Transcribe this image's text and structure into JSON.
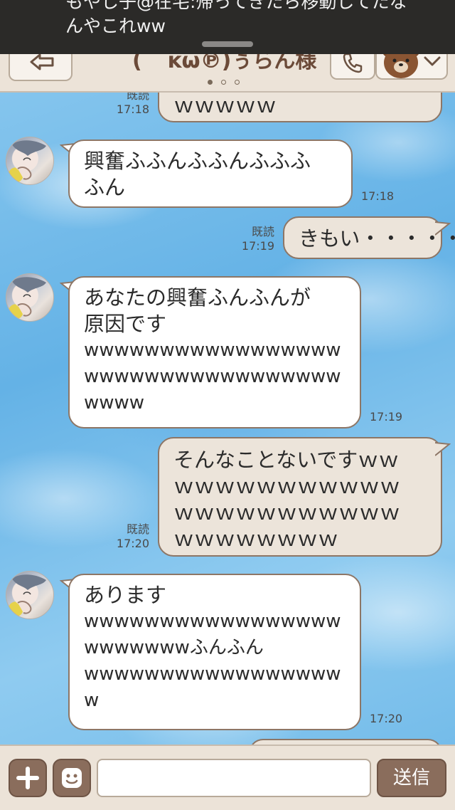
{
  "notification": {
    "text_line1": "もやし子@在宅:帰ってきたら移動してたな",
    "text_line2": "んやこれww"
  },
  "header": {
    "title": "( ˘ ᴋω℗)ぅらん様",
    "page_indicator": {
      "count": 3,
      "active": 1
    }
  },
  "messages": [
    {
      "side": "mine",
      "lines": [
        "ｗｗｗｗｗ"
      ],
      "read": "既読",
      "time": "17:18"
    },
    {
      "side": "theirs",
      "lines": [
        "興奮ふふんふふんふふふ",
        "ふん"
      ],
      "time": "17:18"
    },
    {
      "side": "mine",
      "lines": [
        "きもい・・・・・"
      ],
      "read": "既読",
      "time": "17:19"
    },
    {
      "side": "theirs",
      "lines": [
        "あなたの興奮ふんふんが",
        "原因です",
        "wwwwwwwwwwwwwwwww",
        "wwwwwwwwwwwwwwwww",
        "wwww"
      ],
      "time": "17:19"
    },
    {
      "side": "mine",
      "lines": [
        "そんなことないですｗｗ",
        "ｗｗｗｗｗｗｗｗｗｗｗ",
        "ｗｗｗｗｗｗｗｗｗｗｗ",
        "ｗｗｗｗｗｗｗｗ"
      ],
      "read": "既読",
      "time": "17:20"
    },
    {
      "side": "theirs",
      "lines": [
        "あります",
        "wwwwwwwwwwwwwwwww",
        "wwwwwwwふんふん",
        "wwwwwwwwwwwwwwwww",
        "w"
      ],
      "time": "17:20"
    }
  ],
  "input": {
    "placeholder": "",
    "send_label": "送信"
  },
  "colors": {
    "bubble_border": "#8d7666",
    "mine_bubble": "#ece4da",
    "bar": "#ece3d8",
    "button": "#8a6d5c"
  }
}
